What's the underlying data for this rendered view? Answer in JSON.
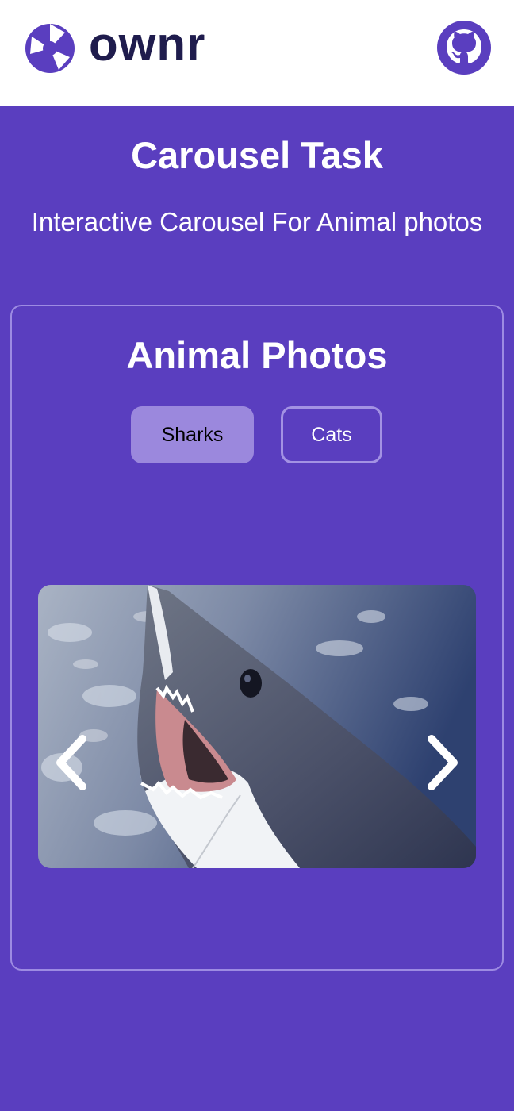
{
  "header": {
    "brand": "ownr",
    "logo_icon": "aperture-logo-icon",
    "github_icon": "github-icon",
    "colors": {
      "brand_text": "#1f1c4d",
      "accent": "#5a3ebf"
    }
  },
  "hero": {
    "title": "Carousel Task",
    "subtitle": "Interactive Carousel For Animal photos"
  },
  "gallery": {
    "title": "Animal Photos",
    "tabs": [
      {
        "label": "Sharks",
        "selected": true
      },
      {
        "label": "Cats",
        "selected": false
      }
    ],
    "prev_icon": "chevron-left-icon",
    "next_icon": "chevron-right-icon",
    "current_image": "shark-photo"
  }
}
